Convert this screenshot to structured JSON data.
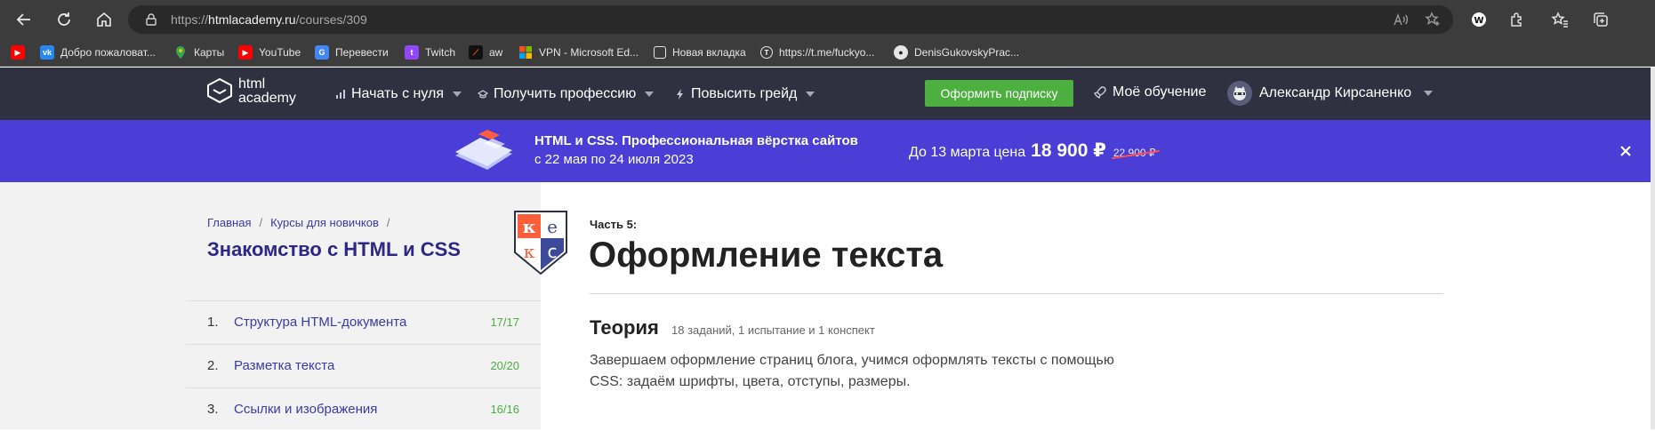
{
  "browser": {
    "url_prefix": "https://",
    "url_host": "htmlacademy.ru",
    "url_path": "/courses/309",
    "bookmarks": [
      {
        "label": "",
        "icon": "youtube-icon",
        "color": "#ff0000"
      },
      {
        "label": "Добро пожаловат...",
        "icon": "vk-icon",
        "color": "#2787f5"
      },
      {
        "label": "Карты",
        "icon": "maps-icon",
        "color": "#34a853"
      },
      {
        "label": "YouTube",
        "icon": "youtube-icon",
        "color": "#ff0000"
      },
      {
        "label": "Перевести",
        "icon": "translate-icon",
        "color": "#4285f4"
      },
      {
        "label": "Twitch",
        "icon": "twitch-icon",
        "color": "#9146ff"
      },
      {
        "label": "aw",
        "icon": "aw-icon",
        "color": "#222222"
      },
      {
        "label": "VPN - Microsoft Ed...",
        "icon": "microsoft-icon",
        "color": "#f25022"
      },
      {
        "label": "Новая вкладка",
        "icon": "new-tab-icon",
        "color": "#3c3c3c"
      },
      {
        "label": "https://t.me/fuckyo...",
        "icon": "tme-icon",
        "color": "#3c3c3c"
      },
      {
        "label": "DenisGukovskyPrac...",
        "icon": "github-icon",
        "color": "#3c3c3c"
      }
    ]
  },
  "header": {
    "logo_line1": "html",
    "logo_line2": "academy",
    "menu": [
      {
        "label": "Начать с нуля"
      },
      {
        "label": "Получить профессию"
      },
      {
        "label": "Повысить грейд"
      }
    ],
    "subscribe_label": "Оформить подписку",
    "my_learning_label": "Моё обучение",
    "user_name": "Александр Кирсаненко"
  },
  "promo": {
    "title": "HTML и CSS. Профессиональная вёрстка сайтов",
    "dates": "с 22 мая по 24 июля 2023",
    "price_prefix": "До 13 марта цена",
    "price": "18 900 ₽",
    "old_price": "22 900 ₽"
  },
  "course": {
    "breadcrumbs": [
      "Главная",
      "Курсы для новичков"
    ],
    "breadcrumb_sep": "/",
    "title": "Знакомство с HTML и CSS",
    "lessons": [
      {
        "num": "1.",
        "name": "Структура HTML-документа",
        "progress": "17/17"
      },
      {
        "num": "2.",
        "name": "Разметка текста",
        "progress": "20/20"
      },
      {
        "num": "3.",
        "name": "Ссылки и изображения",
        "progress": "16/16"
      }
    ],
    "badge_letters": [
      "к",
      "е",
      "к",
      "с"
    ]
  },
  "main": {
    "part_label": "Часть 5:",
    "title": "Оформление текста",
    "section_title": "Теория",
    "section_meta": "18 заданий, 1 испытание и 1 конспект",
    "section_desc": "Завершаем оформление страниц блога, учимся оформлять тексты с помощью CSS: задаём шрифты, цвета, отступы, размеры."
  },
  "colors": {
    "header_bg": "#2f3141",
    "promo_bg": "#4a3ed6",
    "accent_green": "#4caf3f",
    "link_purple": "#3d3aa7"
  }
}
